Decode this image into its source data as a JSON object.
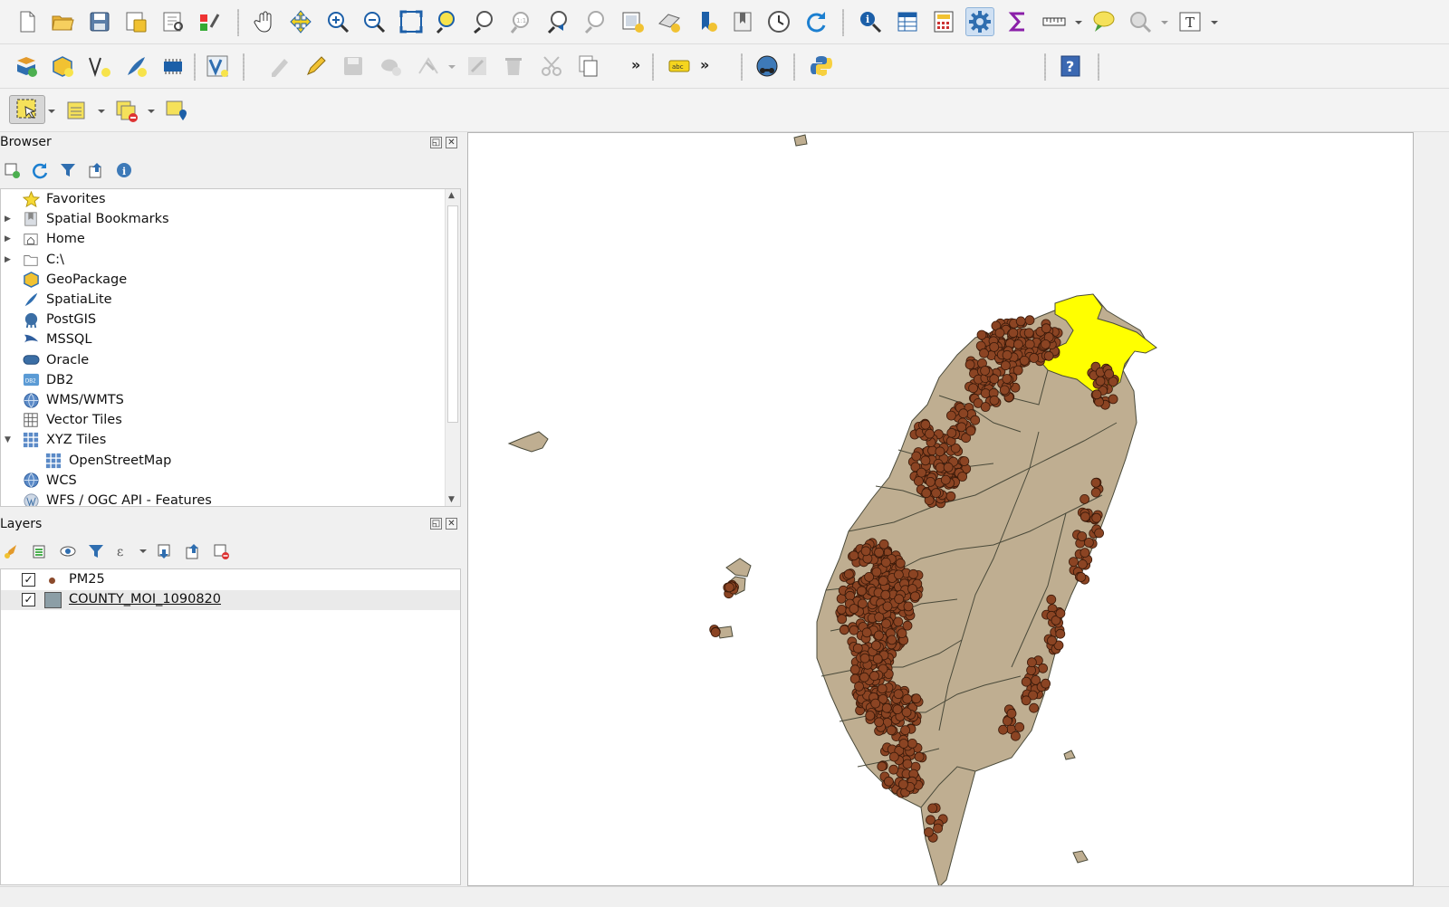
{
  "toolbars": {
    "project": [
      "new-project-icon",
      "open-project-icon",
      "save-project-icon",
      "save-as-icon",
      "print-layout-icon",
      "style-manager-icon"
    ],
    "navigation": [
      "pan-icon",
      "pan-to-selection-icon",
      "zoom-in-icon",
      "zoom-out-icon",
      "zoom-full-icon",
      "zoom-to-selection-icon",
      "zoom-to-layer-icon",
      "zoom-native-icon",
      "zoom-last-icon",
      "zoom-next-icon",
      "new-map-view-icon",
      "new-3d-map-icon",
      "new-bookmark-icon",
      "show-bookmarks-icon",
      "temporal-controller-icon",
      "refresh-icon"
    ],
    "attributes": [
      "identify-icon",
      "open-attribute-table-icon",
      "field-calculator-icon",
      "processing-toolbox-icon",
      "statistics-icon",
      "measure-icon",
      "map-tips-icon",
      "select-by-location-icon",
      "text-annotation-icon"
    ],
    "overflow_chevron": "»",
    "label_tool": "abc"
  },
  "browser_panel": {
    "title": "Browser",
    "items": [
      {
        "label": "Favorites",
        "icon": "star-icon",
        "expander": ""
      },
      {
        "label": "Spatial Bookmarks",
        "icon": "bookmark-icon",
        "expander": "▶"
      },
      {
        "label": "Home",
        "icon": "home-folder-icon",
        "expander": "▶"
      },
      {
        "label": "C:\\",
        "icon": "folder-icon",
        "expander": "▶"
      },
      {
        "label": "GeoPackage",
        "icon": "geopackage-icon",
        "expander": ""
      },
      {
        "label": "SpatiaLite",
        "icon": "spatialite-icon",
        "expander": ""
      },
      {
        "label": "PostGIS",
        "icon": "postgis-icon",
        "expander": ""
      },
      {
        "label": "MSSQL",
        "icon": "mssql-icon",
        "expander": ""
      },
      {
        "label": "Oracle",
        "icon": "oracle-icon",
        "expander": ""
      },
      {
        "label": "DB2",
        "icon": "db2-icon",
        "expander": ""
      },
      {
        "label": "WMS/WMTS",
        "icon": "wms-globe-icon",
        "expander": ""
      },
      {
        "label": "Vector Tiles",
        "icon": "vector-tiles-icon",
        "expander": ""
      },
      {
        "label": "XYZ Tiles",
        "icon": "xyz-tiles-icon",
        "expander": "▼"
      },
      {
        "label": "OpenStreetMap",
        "icon": "xyz-tiles-icon",
        "expander": ""
      },
      {
        "label": "WCS",
        "icon": "wcs-globe-icon",
        "expander": ""
      },
      {
        "label": "WFS / OGC API - Features",
        "icon": "wfs-icon",
        "expander": ""
      }
    ]
  },
  "layers_panel": {
    "title": "Layers",
    "layers": [
      {
        "name": "PM25",
        "checked": "✓",
        "symbol_color": "#8b4a2b",
        "symbol": "point"
      },
      {
        "name": "COUNTY_MOI_1090820",
        "checked": "✓",
        "symbol_color": "#8c9ea6",
        "symbol": "polygon"
      }
    ]
  },
  "map": {
    "land_color": "#bfae91",
    "boundary_color": "#4a4a3a",
    "selected_color": "#ffff00",
    "point_color": "#8b4423",
    "point_outline": "#3a1a0a"
  },
  "colors": {
    "sigma": "#8a1fa8",
    "help": "#3b68b2"
  }
}
